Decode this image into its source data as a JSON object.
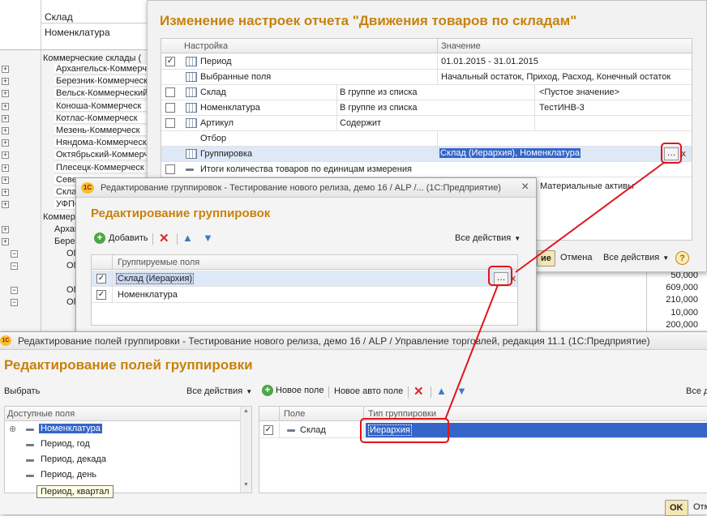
{
  "background_report": {
    "header_lines": [
      "Склад",
      "Номенклатура"
    ],
    "group_title": "Коммерческие склады (",
    "rows": [
      "Архангельск-Коммерч",
      "Березник-Коммерческ",
      "Вельск-Коммерческий",
      "Коноша-Коммерческ",
      "Котлас-Коммерческ",
      "Мезень-Коммерческ",
      "Няндома-Коммерческ",
      "Октябрьский-Коммерч",
      "Плесецк-Коммерческ",
      "Север",
      "Склад",
      "УФПС"
    ],
    "group2_title": "Коммер",
    "rows2": [
      "Архан",
      "Березн",
      "ОП",
      "ОП",
      "ОП",
      "ОП"
    ],
    "numbers": [
      "50,000",
      "609,000",
      "210,000",
      "10,000",
      "200,000"
    ]
  },
  "settings_window": {
    "title": "Изменение настроек отчета \"Движения товаров по складам\"",
    "col_setting": "Настройка",
    "col_value": "Значение",
    "rows": [
      {
        "checked": true,
        "name": "Период",
        "cond": "",
        "value": "01.01.2015 - 31.01.2015"
      },
      {
        "checked": null,
        "name": "Выбранные поля",
        "cond": "",
        "value": "Начальный остаток, Приход, Расход, Конечный остаток"
      },
      {
        "checked": false,
        "name": "Склад",
        "cond": "В группе из списка",
        "value": "<Пустое значение>"
      },
      {
        "checked": false,
        "name": "Номенклатура",
        "cond": "В группе из списка",
        "value": "ТестИНВ-3"
      },
      {
        "checked": false,
        "name": "Артикул",
        "cond": "Содержит",
        "value": ""
      },
      {
        "checked": null,
        "name": "Отбор",
        "cond": "",
        "value": ""
      },
      {
        "checked": null,
        "name": "Группировка",
        "cond": "",
        "value": "Склад (Иерархия), Номенклатура"
      },
      {
        "checked": false,
        "name": "Итоги количества товаров по единицам измерения",
        "cond": "",
        "value": ""
      }
    ],
    "partial_value": "Материальные активы",
    "ok_label": "ие",
    "cancel_label": "Отмена",
    "all_actions": "Все действия",
    "help_label": "?"
  },
  "groupings_window": {
    "titlebar": "Редактирование группировок - Тестирование нового релиза, демо 16 / ALP /...   (1С:Предприятие)",
    "heading": "Редактирование группировок",
    "add_label": "Добавить",
    "all_actions": "Все действия",
    "col_fields": "Группируемые поля",
    "rows": [
      {
        "checked": true,
        "name": "Склад (Иерархия)"
      },
      {
        "checked": true,
        "name": "Номенклатура"
      }
    ]
  },
  "fields_window": {
    "titlebar": "Редактирование полей группировки - Тестирование нового релиза, демо 16 / ALP / Управление торговлей, редакция 11.1  (1С:Предприятие)",
    "heading": "Редактирование полей группировки",
    "select_label": "Выбрать",
    "all_actions": "Все действия",
    "new_field": "Новое поле",
    "new_auto_field": "Новое авто поле",
    "all_actions_right": "Все д",
    "available_header": "Доступные поля",
    "available": [
      "Номенклатура",
      "Период, год",
      "Период, декада",
      "Период, день"
    ],
    "tooltip": "Период, квартал",
    "col_field": "Поле",
    "col_type": "Тип группировки",
    "rows": [
      {
        "checked": true,
        "field": "Склад",
        "type": "Иерархия"
      }
    ],
    "ok_label": "OK",
    "cancel_label": "Отм"
  },
  "colors": {
    "accent": "#c8820a",
    "selection": "#3565c8",
    "highlight": "#e1141c"
  }
}
